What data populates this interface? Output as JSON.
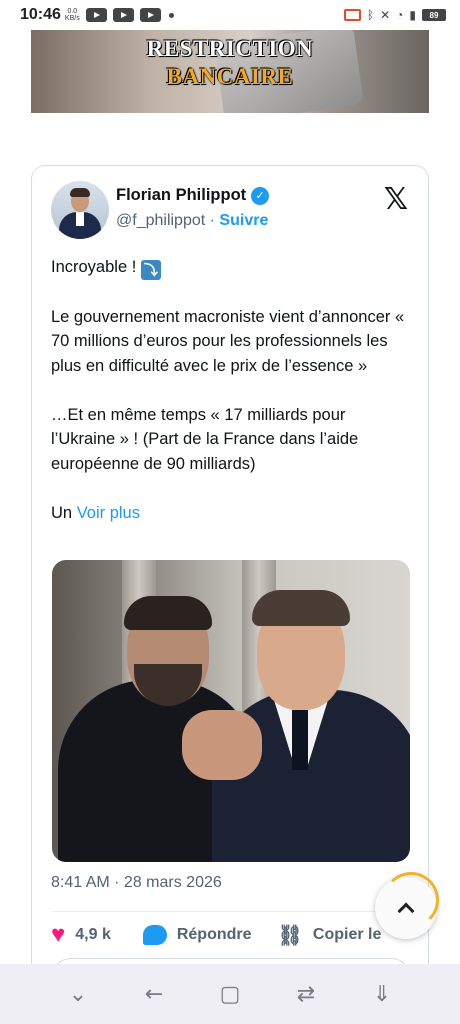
{
  "status_bar": {
    "time": "10:46",
    "net_speed_value": "0.0",
    "net_speed_unit": "KB/s",
    "battery": "89"
  },
  "banner": {
    "line1": "RESTRICTION",
    "line2": "BANCAIRE"
  },
  "tweet": {
    "author_name": "Florian Philippot",
    "handle": "@f_philippot",
    "separator": "·",
    "follow_label": "Suivre",
    "x_logo": "𝕏",
    "text": {
      "line1": "Incroyable !",
      "line1_emoji": "⤵",
      "para2": "Le gouvernement macroniste vient d’annoncer « 70 millions d’euros pour les professionnels les plus en difficulté avec le prix de l’essence »",
      "para3": "…Et en même temps « 17 milliards pour l’Ukraine » ! (Part de la France dans l’aide européenne de 90 milliards)",
      "truncated_prefix": "Un",
      "see_more_label": "Voir plus"
    },
    "timestamp": "8:41 AM · 28 mars 2026",
    "likes": "4,9 k",
    "reply_label": "Répondre",
    "copy_label": "Copier le"
  },
  "icons": {
    "verified": "verified-badge-icon",
    "heart": "heart-icon",
    "reply": "comment-bubble-icon",
    "link": "link-icon",
    "scroll_top": "chevron-up-icon"
  },
  "nav": {
    "collapse": "⌄",
    "back": "←",
    "home": "▢",
    "recents": "⇄",
    "download": "⇓"
  },
  "colors": {
    "accent": "#1d9bf0",
    "like": "#f91880",
    "banner_highlight": "#f0a92a"
  }
}
